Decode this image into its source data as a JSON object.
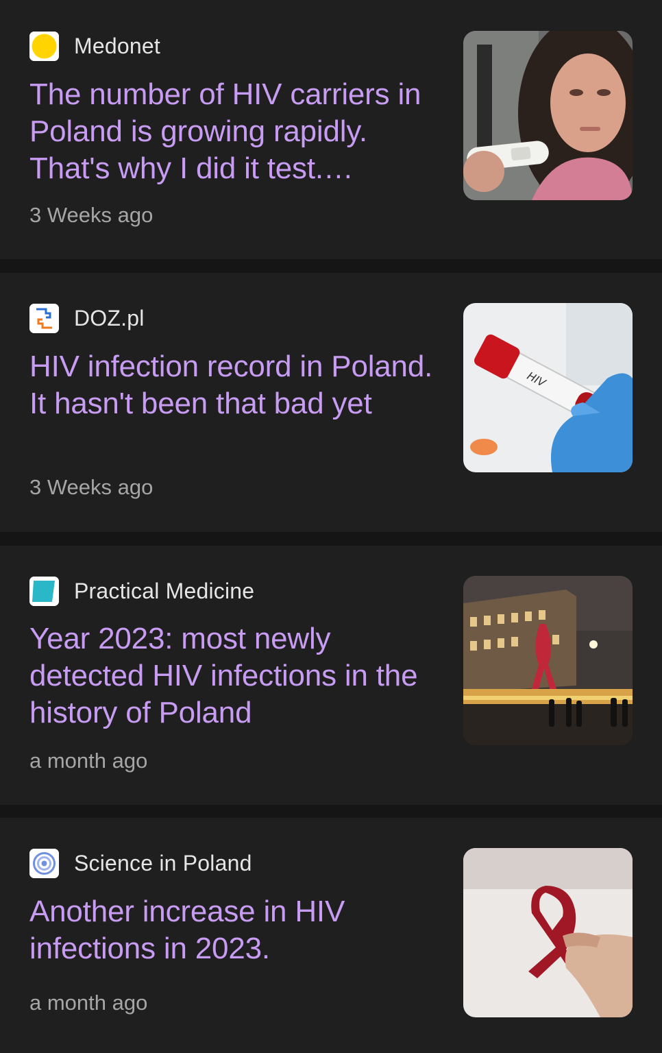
{
  "articles": [
    {
      "source": "Medonet",
      "source_icon": "medonet-logo-icon",
      "headline": "The number of HIV carriers in Poland is growing rapidly. That's why I did it test.…",
      "time": "3 Weeks ago",
      "thumbnail": "woman-holding-hiv-test-photo"
    },
    {
      "source": "DOZ.pl",
      "source_icon": "doz-logo-icon",
      "headline": "HIV infection record in Poland. It hasn't been that bad yet",
      "time": "3 Weeks ago",
      "thumbnail": "gloved-hand-hiv-blood-tube-photo",
      "thumbnail_label": "HIV"
    },
    {
      "source": "Practical Medicine",
      "source_icon": "practical-medicine-logo-icon",
      "headline": "Year 2023: most newly detected HIV infections in the history of Poland",
      "time": "a month ago",
      "thumbnail": "building-with-red-ribbon-night-photo"
    },
    {
      "source": "Science in Poland",
      "source_icon": "science-in-poland-logo-icon",
      "headline": "Another increase in HIV infections in 2023.",
      "time": "a month ago",
      "thumbnail": "hand-holding-red-ribbon-photo"
    }
  ],
  "colors": {
    "background": "#1f1f1f",
    "separator": "#151515",
    "headline": "#c79cf2",
    "source": "#e6e6e6",
    "time": "#a6a6a6"
  }
}
